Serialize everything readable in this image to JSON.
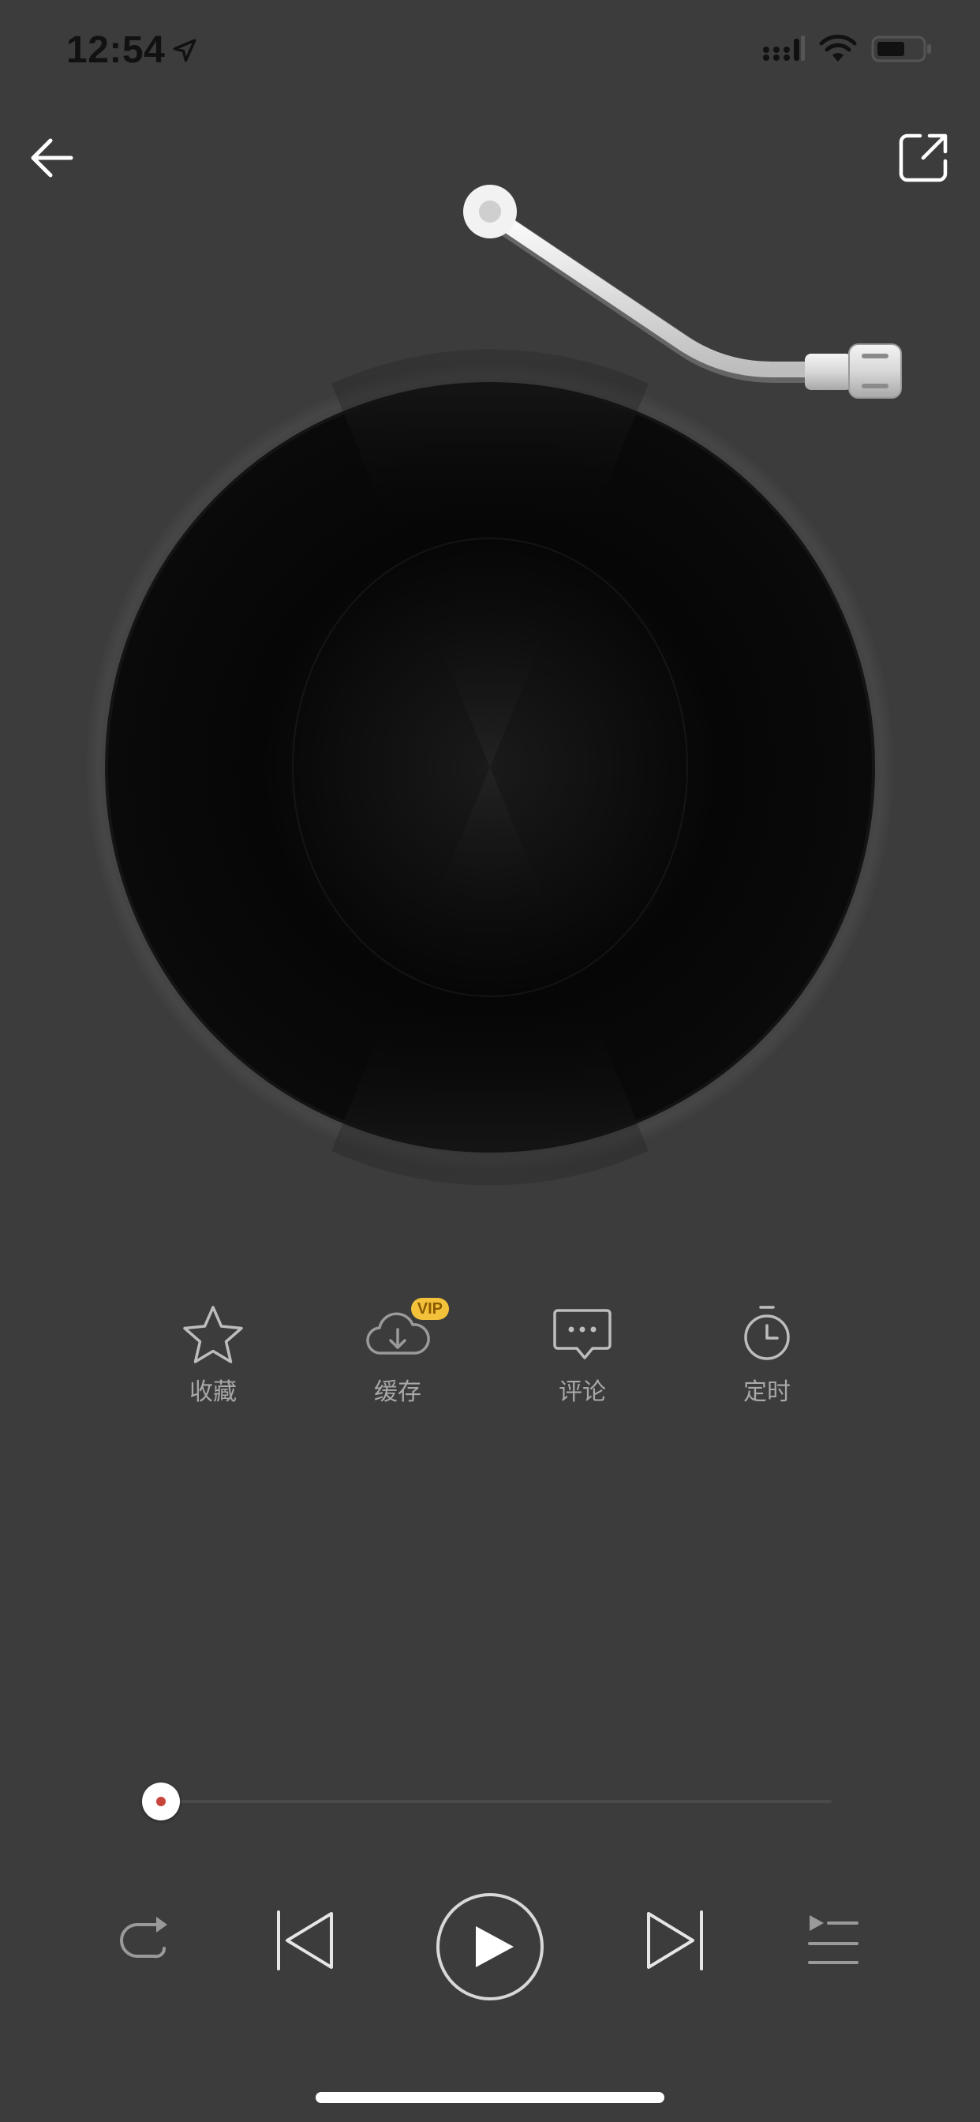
{
  "status_bar": {
    "time": "12:54"
  },
  "actions": [
    {
      "label": "收藏",
      "icon": "star-icon"
    },
    {
      "label": "缓存",
      "icon": "cloud-download-icon",
      "badge": "VIP"
    },
    {
      "label": "评论",
      "icon": "comment-icon"
    },
    {
      "label": "定时",
      "icon": "timer-icon"
    }
  ],
  "progress": {
    "fraction": 0.0
  },
  "colors": {
    "background": "#3c3c3c",
    "accent": "#c9453a",
    "vip": "#f4c23a",
    "label": "#a8a8a8"
  }
}
